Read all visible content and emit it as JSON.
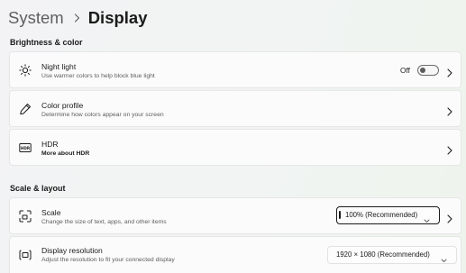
{
  "breadcrumb": {
    "parent": "System",
    "current": "Display"
  },
  "sections": {
    "brightness_color": "Brightness & color",
    "scale_layout": "Scale & layout"
  },
  "night_light": {
    "icon": "brightness-icon",
    "title": "Night light",
    "subtitle": "Use warmer colors to help block blue light",
    "toggle_state": "Off"
  },
  "color_profile": {
    "icon": "pen-icon",
    "title": "Color profile",
    "subtitle": "Determine how colors appear on your screen"
  },
  "hdr": {
    "icon": "hdr-icon",
    "title": "HDR",
    "subtitle": "More about HDR"
  },
  "scale": {
    "icon": "scale-icon",
    "title": "Scale",
    "subtitle": "Change the size of text, apps, and other items",
    "selected": "100% (Recommended)"
  },
  "resolution": {
    "icon": "resolution-icon",
    "title": "Display resolution",
    "subtitle": "Adjust the resolution to fit your connected display",
    "selected": "1920 × 1080 (Recommended)"
  }
}
